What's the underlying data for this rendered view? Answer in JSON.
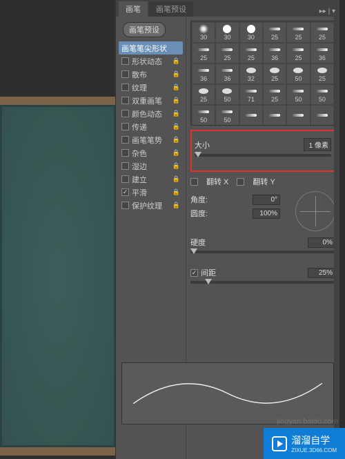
{
  "tabs": {
    "brush": "画笔",
    "presets": "画笔预设"
  },
  "presetButton": "画笔预设",
  "options": [
    {
      "label": "画笔笔尖形状",
      "checked": null,
      "locked": false,
      "selected": true
    },
    {
      "label": "形状动态",
      "checked": false,
      "locked": true
    },
    {
      "label": "散布",
      "checked": false,
      "locked": true
    },
    {
      "label": "纹理",
      "checked": false,
      "locked": true
    },
    {
      "label": "双重画笔",
      "checked": false,
      "locked": true
    },
    {
      "label": "颜色动态",
      "checked": false,
      "locked": true
    },
    {
      "label": "传递",
      "checked": false,
      "locked": true
    },
    {
      "label": "画笔笔势",
      "checked": false,
      "locked": true
    },
    {
      "label": "杂色",
      "checked": false,
      "locked": true
    },
    {
      "label": "湿边",
      "checked": false,
      "locked": true
    },
    {
      "label": "建立",
      "checked": false,
      "locked": true
    },
    {
      "label": "平滑",
      "checked": true,
      "locked": true
    },
    {
      "label": "保护纹理",
      "checked": false,
      "locked": true
    }
  ],
  "brushTips": [
    {
      "size": "30",
      "type": "soft"
    },
    {
      "size": "30",
      "type": "hard"
    },
    {
      "size": "30",
      "type": "hard"
    },
    {
      "size": "25",
      "type": "flat"
    },
    {
      "size": "25",
      "type": "flat"
    },
    {
      "size": "25",
      "type": "flat"
    },
    {
      "size": "25",
      "type": "flat"
    },
    {
      "size": "25",
      "type": "flat"
    },
    {
      "size": "25",
      "type": "flat"
    },
    {
      "size": "36",
      "type": "flat"
    },
    {
      "size": "25",
      "type": "flat"
    },
    {
      "size": "36",
      "type": "flat"
    },
    {
      "size": "36",
      "type": "flat"
    },
    {
      "size": "36",
      "type": "flat"
    },
    {
      "size": "32",
      "type": "round"
    },
    {
      "size": "25",
      "type": "round"
    },
    {
      "size": "50",
      "type": "round"
    },
    {
      "size": "25",
      "type": "round"
    },
    {
      "size": "25",
      "type": "round"
    },
    {
      "size": "50",
      "type": "round"
    },
    {
      "size": "71",
      "type": "flat"
    },
    {
      "size": "25",
      "type": "flat"
    },
    {
      "size": "50",
      "type": "flat"
    },
    {
      "size": "50",
      "type": "flat"
    },
    {
      "size": "50",
      "type": "flat"
    },
    {
      "size": "50",
      "type": "flat"
    },
    {
      "size": "",
      "type": "flat"
    },
    {
      "size": "",
      "type": "flat"
    },
    {
      "size": "",
      "type": "flat"
    },
    {
      "size": "",
      "type": "flat"
    }
  ],
  "size": {
    "label": "大小",
    "value": "1 像素"
  },
  "flip": {
    "x": "翻转 X",
    "y": "翻转 Y"
  },
  "angle": {
    "label": "角度:",
    "value": "0°"
  },
  "roundness": {
    "label": "圆度:",
    "value": "100%"
  },
  "hardness": {
    "label": "硬度",
    "value": "0%"
  },
  "spacing": {
    "label": "间距",
    "value": "25%"
  },
  "watermark": {
    "brand": "溜溜自学",
    "domain": "ZIXUE.3D66.COM"
  }
}
